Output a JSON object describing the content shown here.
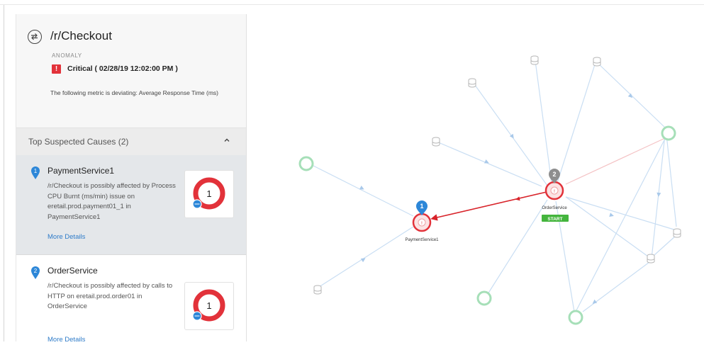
{
  "header": {
    "title": "/r/Checkout",
    "anomaly_label": "ANOMALY",
    "severity": "Critical ( 02/28/19 12:02:00 PM )",
    "description": "The following metric is deviating: Average Response Time (ms)"
  },
  "causes": {
    "title": "Top Suspected Causes (2)",
    "items": [
      {
        "rank": "1",
        "name": "PaymentService1",
        "description": "/r/Checkout is possibly affected by Process CPU Burnt (ms/min) issue on eretail.prod.payment01_1 in PaymentService1",
        "link": "More Details",
        "donut_value": "1"
      },
      {
        "rank": "2",
        "name": "OrderService",
        "description": "/r/Checkout is possibly affected by calls to HTTP on eretail.prod.order01 in OrderService",
        "link": "More Details",
        "donut_value": "1"
      }
    ]
  },
  "graph": {
    "payment_node_label": "PaymentService1",
    "order_node_label": "OrderService",
    "start_badge": "START",
    "payment_pin": "1",
    "order_pin": "2",
    "node_alert": "!"
  },
  "colors": {
    "critical": "#e2323a",
    "pin_blue": "#2d87d8",
    "pin_gray": "#8e8e8e",
    "healthy_ring": "#a6dfb8",
    "edge": "#c9def3",
    "start_green": "#44b53d",
    "link_blue": "#2f7cc9"
  }
}
